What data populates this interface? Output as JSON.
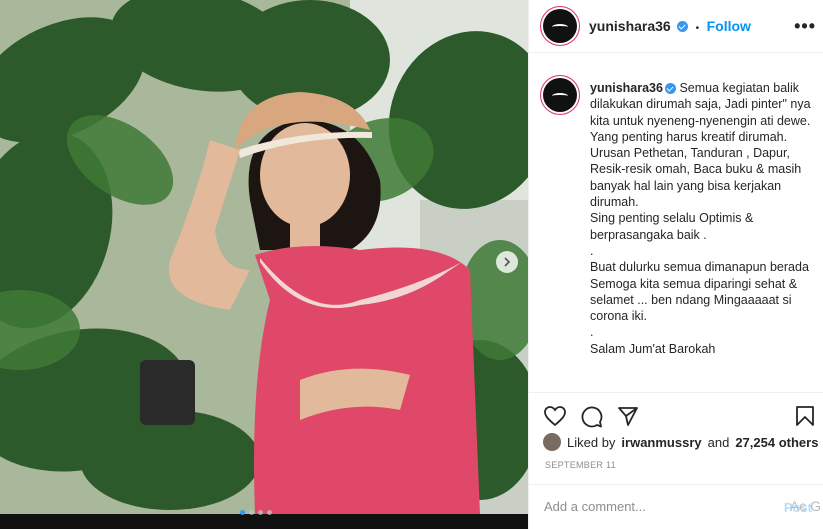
{
  "post": {
    "username": "yunishara36",
    "follow_label": "Follow",
    "separator": "•",
    "more_label": "•••",
    "caption_lines": "Semua kegiatan balik dilakukan dirumah saja, Jadi pinter\" nya kita untuk nyeneng-nyenengin ati dewe.\nYang penting harus kreatif dirumah.\nUrusan Pethetan, Tanduran , Dapur, Resik-resik omah, Baca buku & masih banyak hal lain yang bisa kerjakan dirumah.\nSing penting selalu Optimis & berprasangaka baik .\n.\nBuat dulurku semua dimanapun berada\nSemoga kita semua diparingi sehat & selamet ... ben ndang Mingaaaaat si corona iki.\n.\nSalam Jum'at Barokah",
    "liked_prefix": "Liked by",
    "liked_user": "irwanmussry",
    "liked_and": "and",
    "liked_count": "27,254 others",
    "date": "September 11",
    "comment_placeholder": "Add a comment...",
    "post_label": "Post",
    "watermark": "Ac G"
  },
  "carousel": {
    "total_slides": 4,
    "active_slide": 1
  },
  "icons": [
    "verified-badge-icon",
    "more-options-icon",
    "like-heart-icon",
    "comment-icon",
    "share-send-icon",
    "save-bookmark-icon",
    "carousel-next-icon"
  ],
  "colors": {
    "link_blue": "#0095f6",
    "verified_blue": "#3897f0",
    "post_disabled": "#b2dffc",
    "dress_pink": "#e0486a",
    "leaf_green": "#2f5a2c"
  }
}
